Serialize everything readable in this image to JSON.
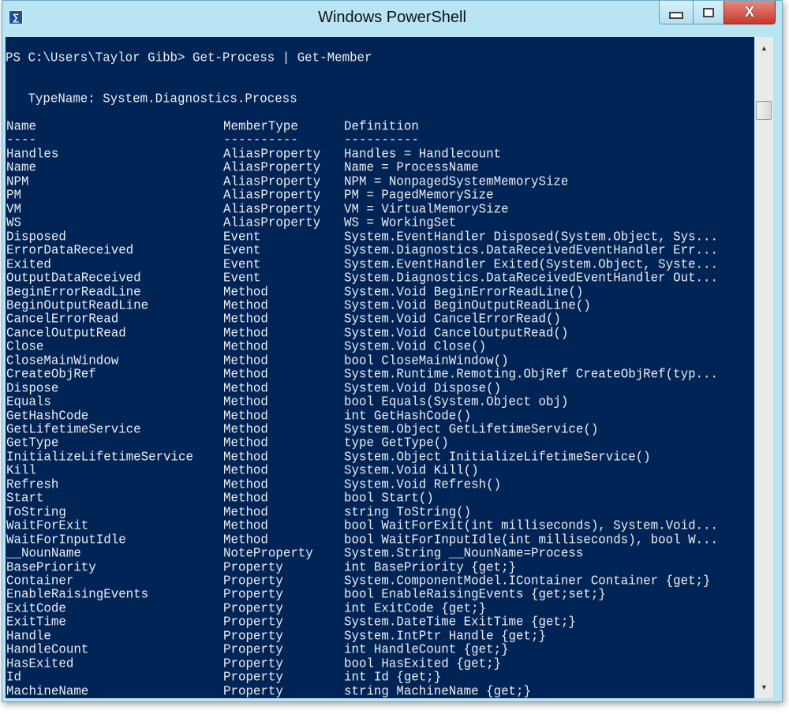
{
  "window": {
    "title": "Windows PowerShell",
    "icon": "powershell-icon",
    "close_glyph": "X"
  },
  "console": {
    "prompt": "PS C:\\Users\\Taylor Gibb> Get-Process | Get-Member",
    "typename": "   TypeName: System.Diagnostics.Process",
    "headers": [
      "Name",
      "MemberType",
      "Definition"
    ],
    "underlines": [
      "----",
      "----------",
      "----------"
    ],
    "rows": [
      [
        "Handles",
        "AliasProperty",
        "Handles = Handlecount"
      ],
      [
        "Name",
        "AliasProperty",
        "Name = ProcessName"
      ],
      [
        "NPM",
        "AliasProperty",
        "NPM = NonpagedSystemMemorySize"
      ],
      [
        "PM",
        "AliasProperty",
        "PM = PagedMemorySize"
      ],
      [
        "VM",
        "AliasProperty",
        "VM = VirtualMemorySize"
      ],
      [
        "WS",
        "AliasProperty",
        "WS = WorkingSet"
      ],
      [
        "Disposed",
        "Event",
        "System.EventHandler Disposed(System.Object, Sys..."
      ],
      [
        "ErrorDataReceived",
        "Event",
        "System.Diagnostics.DataReceivedEventHandler Err..."
      ],
      [
        "Exited",
        "Event",
        "System.EventHandler Exited(System.Object, Syste..."
      ],
      [
        "OutputDataReceived",
        "Event",
        "System.Diagnostics.DataReceivedEventHandler Out..."
      ],
      [
        "BeginErrorReadLine",
        "Method",
        "System.Void BeginErrorReadLine()"
      ],
      [
        "BeginOutputReadLine",
        "Method",
        "System.Void BeginOutputReadLine()"
      ],
      [
        "CancelErrorRead",
        "Method",
        "System.Void CancelErrorRead()"
      ],
      [
        "CancelOutputRead",
        "Method",
        "System.Void CancelOutputRead()"
      ],
      [
        "Close",
        "Method",
        "System.Void Close()"
      ],
      [
        "CloseMainWindow",
        "Method",
        "bool CloseMainWindow()"
      ],
      [
        "CreateObjRef",
        "Method",
        "System.Runtime.Remoting.ObjRef CreateObjRef(typ..."
      ],
      [
        "Dispose",
        "Method",
        "System.Void Dispose()"
      ],
      [
        "Equals",
        "Method",
        "bool Equals(System.Object obj)"
      ],
      [
        "GetHashCode",
        "Method",
        "int GetHashCode()"
      ],
      [
        "GetLifetimeService",
        "Method",
        "System.Object GetLifetimeService()"
      ],
      [
        "GetType",
        "Method",
        "type GetType()"
      ],
      [
        "InitializeLifetimeService",
        "Method",
        "System.Object InitializeLifetimeService()"
      ],
      [
        "Kill",
        "Method",
        "System.Void Kill()"
      ],
      [
        "Refresh",
        "Method",
        "System.Void Refresh()"
      ],
      [
        "Start",
        "Method",
        "bool Start()"
      ],
      [
        "ToString",
        "Method",
        "string ToString()"
      ],
      [
        "WaitForExit",
        "Method",
        "bool WaitForExit(int milliseconds), System.Void..."
      ],
      [
        "WaitForInputIdle",
        "Method",
        "bool WaitForInputIdle(int milliseconds), bool W..."
      ],
      [
        "__NounName",
        "NoteProperty",
        "System.String __NounName=Process"
      ],
      [
        "BasePriority",
        "Property",
        "int BasePriority {get;}"
      ],
      [
        "Container",
        "Property",
        "System.ComponentModel.IContainer Container {get;}"
      ],
      [
        "EnableRaisingEvents",
        "Property",
        "bool EnableRaisingEvents {get;set;}"
      ],
      [
        "ExitCode",
        "Property",
        "int ExitCode {get;}"
      ],
      [
        "ExitTime",
        "Property",
        "System.DateTime ExitTime {get;}"
      ],
      [
        "Handle",
        "Property",
        "System.IntPtr Handle {get;}"
      ],
      [
        "HandleCount",
        "Property",
        "int HandleCount {get;}"
      ],
      [
        "HasExited",
        "Property",
        "bool HasExited {get;}"
      ],
      [
        "Id",
        "Property",
        "int Id {get;}"
      ],
      [
        "MachineName",
        "Property",
        "string MachineName {get;}"
      ]
    ]
  },
  "colors": {
    "console_bg": "#012456",
    "console_fg": "#eeedf0",
    "titlebar": "#b9e4f3",
    "close_button": "#c7382c"
  }
}
